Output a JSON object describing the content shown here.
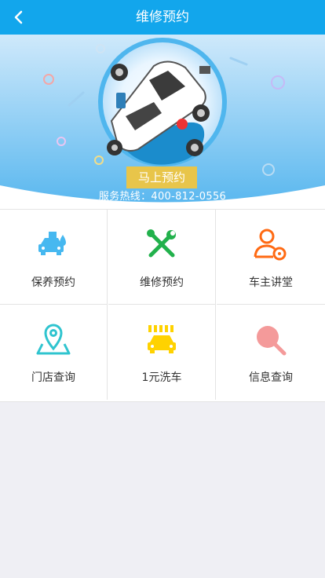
{
  "header": {
    "title": "维修预约"
  },
  "banner": {
    "cta_label": "马上预约",
    "hotline": "服务热线：400-812-0556"
  },
  "services": [
    {
      "label": "保养预约",
      "icon": "car-maintenance-icon",
      "color": "#46b8f0"
    },
    {
      "label": "维修预约",
      "icon": "wrench-screwdriver-icon",
      "color": "#22b14c"
    },
    {
      "label": "车主讲堂",
      "icon": "user-gear-icon",
      "color": "#ff6a13"
    },
    {
      "label": "门店查询",
      "icon": "location-pin-icon",
      "color": "#2fc4cf"
    },
    {
      "label": "1元洗车",
      "icon": "car-wash-icon",
      "color": "#ffd200"
    },
    {
      "label": "信息查询",
      "icon": "magnifier-icon",
      "color": "#f49a9a"
    }
  ]
}
